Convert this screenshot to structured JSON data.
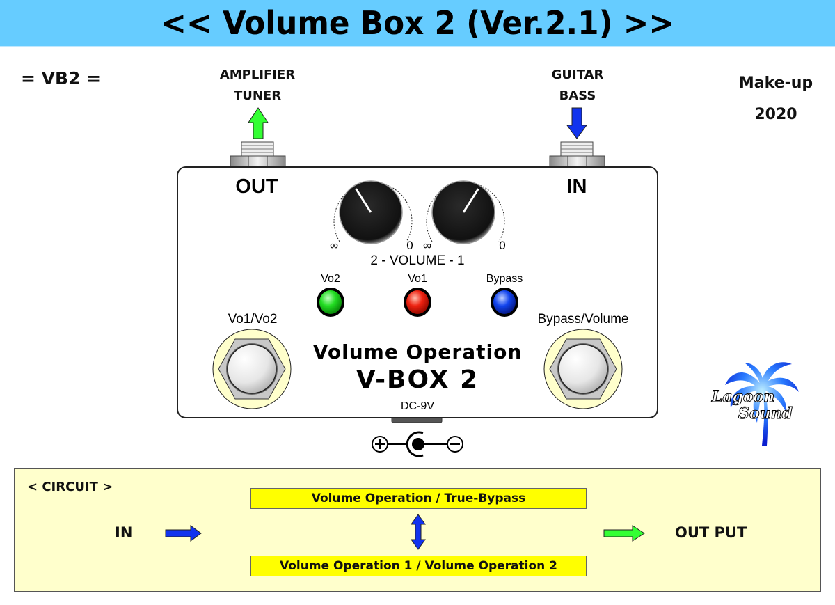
{
  "title": "<< Volume Box 2 (Ver.2.1) >>",
  "model_code": "= VB2 =",
  "output_destination": [
    "AMPLIFIER",
    "TUNER"
  ],
  "input_source": [
    "GUITAR",
    "BASS"
  ],
  "makeup": [
    "Make-up",
    "2020"
  ],
  "pedal": {
    "jacks": {
      "out_label": "OUT",
      "in_label": "IN"
    },
    "knobs": [
      {
        "name": "Volume 2",
        "min_label": "∞",
        "max_label": "0",
        "position_fraction": 0.38
      },
      {
        "name": "Volume 1",
        "min_label": "∞",
        "max_label": "0",
        "position_fraction": 0.62
      }
    ],
    "knob_caption": "2 - VOLUME - 1",
    "leds": [
      {
        "label": "Vo2",
        "color": "#22dd22"
      },
      {
        "label": "Vo1",
        "color": "#ee2211"
      },
      {
        "label": "Bypass",
        "color": "#1144ee"
      }
    ],
    "footswitches": [
      {
        "label": "Vo1/Vo2"
      },
      {
        "label": "Bypass/Volume"
      }
    ],
    "name_line1": "Volume Operation",
    "name_line2": "V-BOX 2",
    "power_label": "DC-9V",
    "polarity_plus": "+",
    "polarity_minus": "−"
  },
  "logo": {
    "line1": "Lagoon",
    "line2": "Sound"
  },
  "circuit": {
    "title": "< CIRCUIT >",
    "in_label": "IN",
    "out_label": "OUT PUT",
    "mode_top": "Volume Operation / True-Bypass",
    "mode_bottom": "Volume Operation 1 / Volume Operation 2"
  },
  "colors": {
    "title_bg": "#66ccff",
    "arrow_out": "#33ff33",
    "arrow_in": "#1133ee",
    "circuit_bg": "#ffffcc",
    "mode_box": "#ffff00"
  }
}
